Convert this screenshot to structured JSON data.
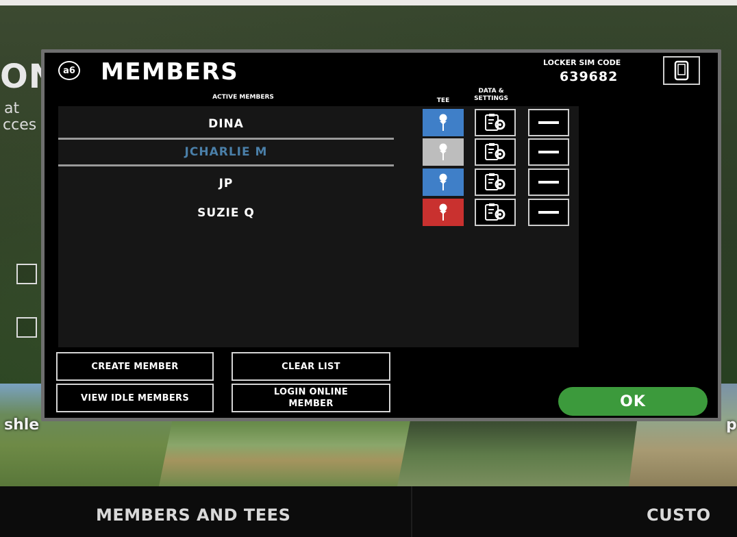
{
  "background": {
    "heading_partial": "ON",
    "line1_partial": "at",
    "line2_partial": "cces",
    "courses": [
      {
        "label": "shle"
      },
      {
        "label": ""
      },
      {
        "label": ""
      },
      {
        "label": "p"
      }
    ],
    "bottom_tabs": [
      {
        "label": "MEMBERS AND TEES"
      },
      {
        "label": "CUSTO"
      }
    ]
  },
  "modal": {
    "logo_text": "a6",
    "title": "MEMBERS",
    "locker_sim_code_label": "LOCKER SIM CODE",
    "locker_sim_code": "639682",
    "active_members_label": "ACTIVE MEMBERS",
    "tee_label": "TEE",
    "data_settings_label_1": "DATA &",
    "data_settings_label_2": "SETTINGS",
    "members": [
      {
        "name": "DINA",
        "tee_color": "blue",
        "selected": false
      },
      {
        "name": "JCHARLIE M",
        "tee_color": "white",
        "selected": true
      },
      {
        "name": "JP",
        "tee_color": "blue",
        "selected": false
      },
      {
        "name": "SUZIE Q",
        "tee_color": "red",
        "selected": false
      }
    ],
    "buttons": {
      "create_member": "CREATE MEMBER",
      "clear_list": "CLEAR LIST",
      "view_idle_members": "VIEW IDLE MEMBERS",
      "login_online_line1": "LOGIN ONLINE",
      "login_online_line2": "MEMBER",
      "ok": "OK"
    }
  },
  "colors": {
    "tee_blue": "#3f7fc8",
    "tee_white": "#bdbdbd",
    "tee_red": "#c9312f",
    "ok_green": "#3c9a3c",
    "selected_name": "#4a7fa8"
  }
}
